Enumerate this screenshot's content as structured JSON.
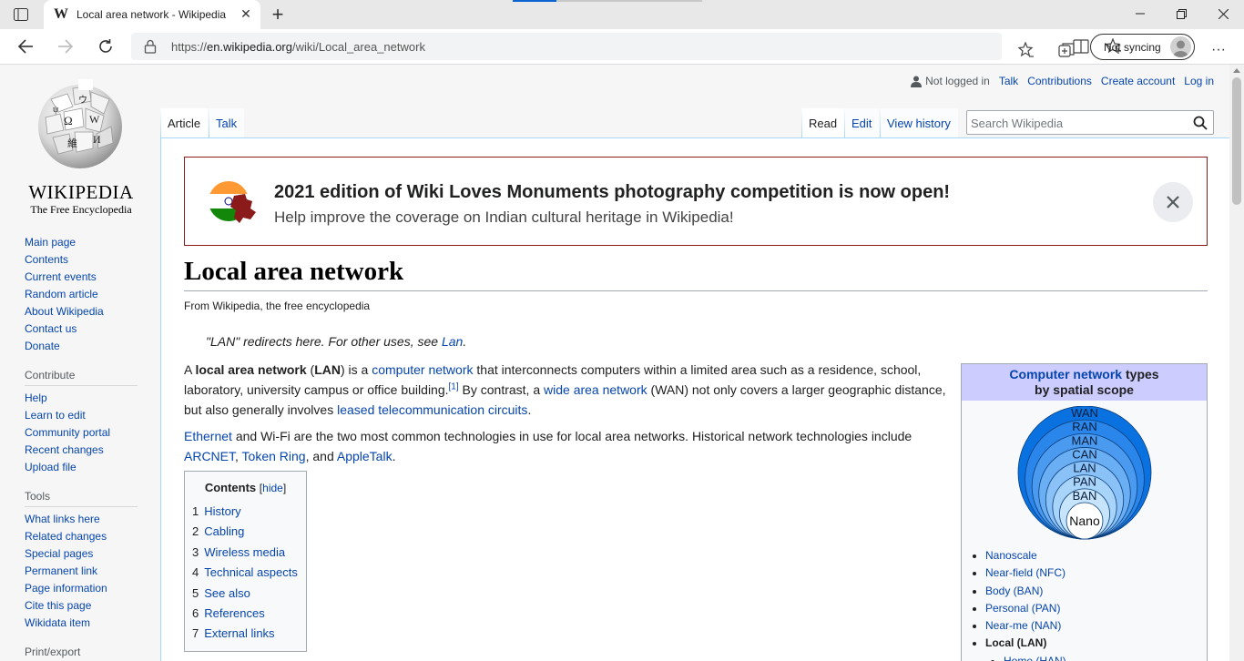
{
  "browser": {
    "tab_title": "Local area network - Wikipedia",
    "tab_favicon": "W",
    "url_prefix": "https://",
    "url_host": "en.wikipedia.org",
    "url_path": "/wiki/Local_area_network",
    "sync_label": "Not syncing"
  },
  "logo": {
    "wordmark": "WIKIPEDIA",
    "tagline": "The Free Encyclopedia"
  },
  "sidebar": {
    "main": [
      "Main page",
      "Contents",
      "Current events",
      "Random article",
      "About Wikipedia",
      "Contact us",
      "Donate"
    ],
    "contribute_heading": "Contribute",
    "contribute": [
      "Help",
      "Learn to edit",
      "Community portal",
      "Recent changes",
      "Upload file"
    ],
    "tools_heading": "Tools",
    "tools": [
      "What links here",
      "Related changes",
      "Special pages",
      "Permanent link",
      "Page information",
      "Cite this page",
      "Wikidata item"
    ],
    "print_heading": "Print/export"
  },
  "usermenu": {
    "not_logged_in": "Not logged in",
    "talk": "Talk",
    "contributions": "Contributions",
    "create_account": "Create account",
    "log_in": "Log in"
  },
  "tabs": {
    "article": "Article",
    "talk": "Talk",
    "read": "Read",
    "edit": "Edit",
    "view_history": "View history"
  },
  "search": {
    "placeholder": "Search Wikipedia"
  },
  "banner": {
    "headline": "2021 edition of Wiki Loves Monuments photography competition is now open!",
    "subline": "Help improve the coverage on Indian cultural heritage in Wikipedia!"
  },
  "article": {
    "title": "Local area network",
    "from": "From Wikipedia, the free encyclopedia",
    "hatnote_pre": "\"LAN\" redirects here. For other uses, see ",
    "hatnote_link": "Lan",
    "hatnote_post": ".",
    "p1": {
      "t1": "A ",
      "b1": "local area network",
      "t2": " (",
      "b2": "LAN",
      "t3": ") is a ",
      "l1": "computer network",
      "t4": " that interconnects computers within a limited area such as a residence, school, laboratory, university campus or office building.",
      "ref": "[1]",
      "t5": " By contrast, a ",
      "l2": "wide area network",
      "t6": " (WAN) not only covers a larger geographic distance, but also generally involves ",
      "l3": "leased telecommunication circuits",
      "t7": "."
    },
    "p2": {
      "l1": "Ethernet",
      "t1": " and ",
      "l2": "Wi-Fi",
      "t2": " are the two most common technologies in use for local area networks. Historical network technologies include ",
      "l3": "ARCNET",
      "t3": ", ",
      "l4": "Token Ring",
      "t4": ", and ",
      "l5": "AppleTalk",
      "t5": "."
    }
  },
  "toc": {
    "title": "Contents",
    "hide": "hide",
    "items": [
      {
        "num": "1",
        "label": "History"
      },
      {
        "num": "2",
        "label": "Cabling"
      },
      {
        "num": "3",
        "label": "Wireless media"
      },
      {
        "num": "4",
        "label": "Technical aspects"
      },
      {
        "num": "5",
        "label": "See also"
      },
      {
        "num": "6",
        "label": "References"
      },
      {
        "num": "7",
        "label": "External links"
      }
    ]
  },
  "infobox": {
    "title_link": "Computer network",
    "title_rest": " types",
    "title_line2": "by spatial scope",
    "diagram_labels": [
      "WAN",
      "RAN",
      "MAN",
      "CAN",
      "LAN",
      "PAN",
      "BAN",
      "Nano"
    ],
    "items": [
      "Nanoscale",
      "Near-field (NFC)",
      "Body (BAN)",
      "Personal (PAN)",
      "Near-me (NAN)",
      "Local (LAN)",
      "Home (HAN)"
    ]
  },
  "colors": {
    "link": "#0645ad",
    "banner_border": "#8b1a1a",
    "infobox_header": "#ccccff"
  }
}
